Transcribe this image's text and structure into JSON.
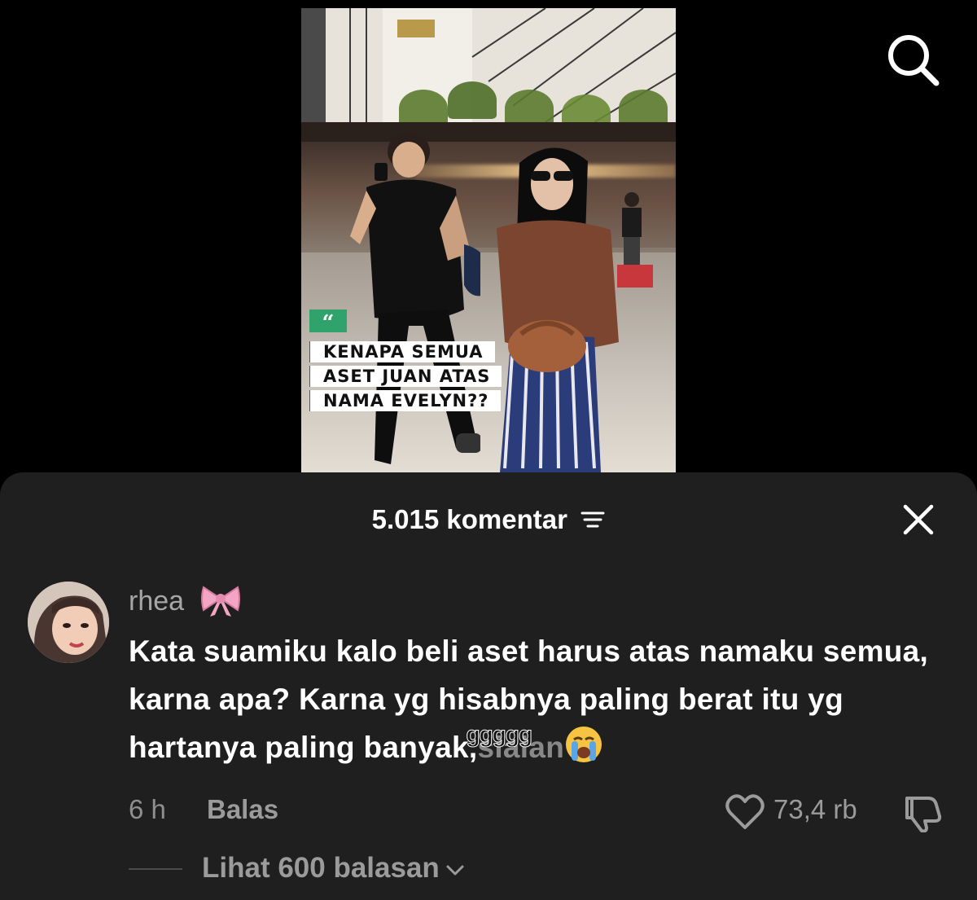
{
  "video": {
    "caption_lines": [
      "KENAPA SEMUA",
      "ASET JUAN ATAS",
      "NAMA EVELYN??"
    ],
    "quote_mark": "“",
    "accent_color": "#2fa36b"
  },
  "top_bar": {
    "search_icon": "search-icon"
  },
  "comments": {
    "count_label": "5.015 komentar",
    "filter_icon": "filter-icon",
    "close_icon": "close-icon",
    "comment": {
      "username": "rhea",
      "username_emoji": "ribbon",
      "text_main": "Kata suamiku kalo beli aset harus atas namaku semua, karna apa? Karna yg hisabnya paling berat itu yg hartanya paling banyak,",
      "text_struck": " sialan",
      "text_overwrite": "ggggg",
      "trailing_emoji": "loudly-crying-face",
      "time": "6 h",
      "reply_label": "Balas",
      "likes": "73,4 rb",
      "view_replies": "Lihat 600 balasan"
    }
  },
  "colors": {
    "sheet_bg": "#1f1f1f",
    "muted_text": "#9b9b9b"
  }
}
